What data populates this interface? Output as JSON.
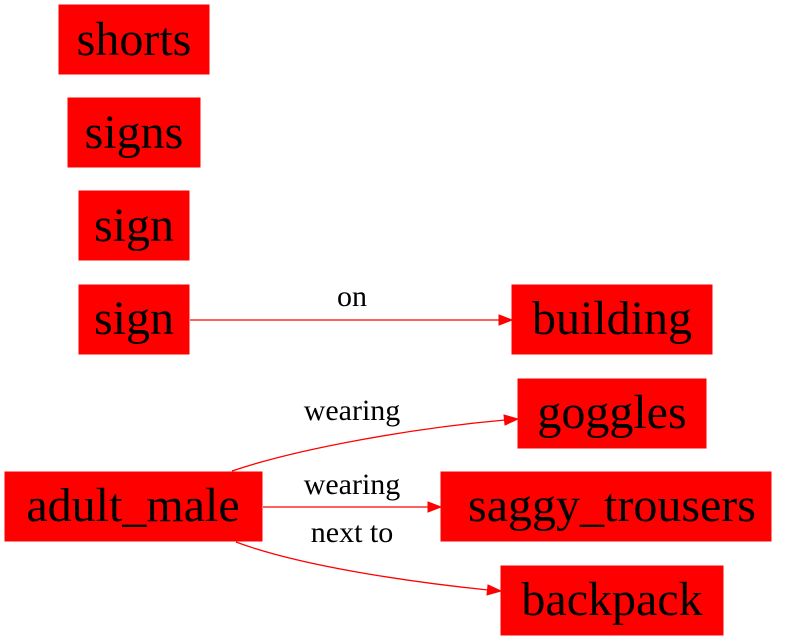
{
  "colors": {
    "node_fill": "#ff0000",
    "edge": "#ff0000",
    "text": "#000000",
    "background": "#ffffff"
  },
  "nodes": {
    "shorts": "shorts",
    "signs": "signs",
    "sign_1": "sign",
    "sign_2": "sign",
    "building": "building",
    "adult_male": "adult_male",
    "goggles": "goggles",
    "saggy_trousers": "saggy_trousers",
    "backpack": "backpack"
  },
  "edges": [
    {
      "from": "sign_2",
      "to": "building",
      "label": "on"
    },
    {
      "from": "adult_male",
      "to": "goggles",
      "label": "wearing"
    },
    {
      "from": "adult_male",
      "to": "saggy_trousers",
      "label": "wearing"
    },
    {
      "from": "adult_male",
      "to": "backpack",
      "label": "next to"
    }
  ]
}
